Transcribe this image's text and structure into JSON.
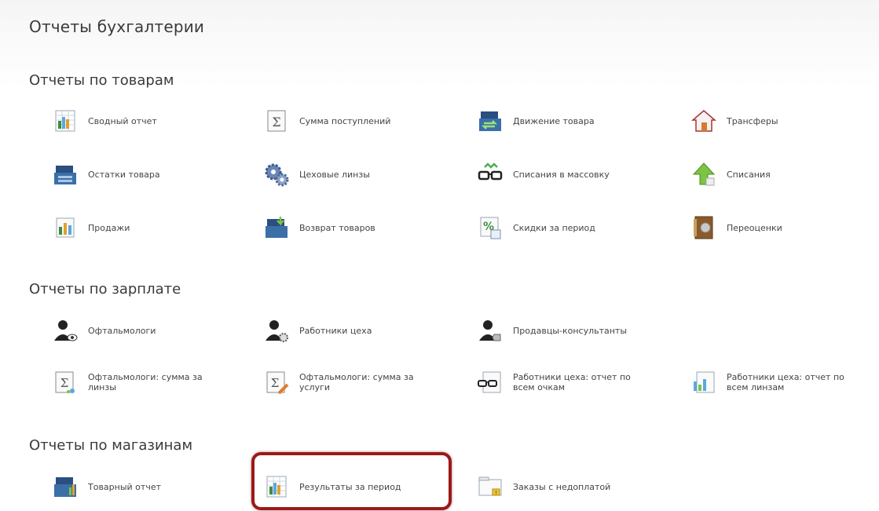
{
  "page": {
    "title": "Отчеты бухгалтерии"
  },
  "sections": [
    {
      "title": "Отчеты по товарам",
      "items": [
        {
          "label": "Сводный отчет",
          "icon": "spreadsheet-chart-icon"
        },
        {
          "label": "Сумма поступлений",
          "icon": "sigma-icon"
        },
        {
          "label": "Движение товара",
          "icon": "cash-register-arrows-icon"
        },
        {
          "label": "Трансферы",
          "icon": "house-icon"
        },
        {
          "label": "Остатки товара",
          "icon": "cash-register-icon"
        },
        {
          "label": "Цеховые линзы",
          "icon": "gears-icon"
        },
        {
          "label": "Списания в массовку",
          "icon": "glasses-icon"
        },
        {
          "label": "Списания",
          "icon": "arrow-up-icon"
        },
        {
          "label": "Продажи",
          "icon": "bar-chart-icon"
        },
        {
          "label": "Возврат товаров",
          "icon": "cash-register-return-icon"
        },
        {
          "label": "Скидки за период",
          "icon": "percent-calendar-icon"
        },
        {
          "label": "Переоценки",
          "icon": "price-book-icon"
        }
      ]
    },
    {
      "title": "Отчеты по зарплате",
      "items": [
        {
          "label": "Офтальмологи",
          "icon": "user-eye-icon"
        },
        {
          "label": "Работники цеха",
          "icon": "user-gear-icon"
        },
        {
          "label": "Продавцы-консультанты",
          "icon": "user-tag-icon"
        },
        {
          "label": "Офтальмологи: сумма за линзы",
          "icon": "sigma-lens-icon"
        },
        {
          "label": "Офтальмологи: сумма за услуги",
          "icon": "sigma-pencil-icon"
        },
        {
          "label": "Работники цеха: отчет по всем очкам",
          "icon": "glasses-report-icon"
        },
        {
          "label": "Работники цеха: отчет по всем линзам",
          "icon": "lenses-report-icon"
        }
      ]
    },
    {
      "title": "Отчеты по магазинам",
      "items": [
        {
          "label": "Товарный отчет",
          "icon": "cash-register-chart-icon"
        },
        {
          "label": "Результаты за период",
          "icon": "spreadsheet-chart-icon"
        },
        {
          "label": "Заказы с недоплатой",
          "icon": "folder-warning-icon"
        }
      ]
    }
  ],
  "highlighted_item": "Результаты за период"
}
